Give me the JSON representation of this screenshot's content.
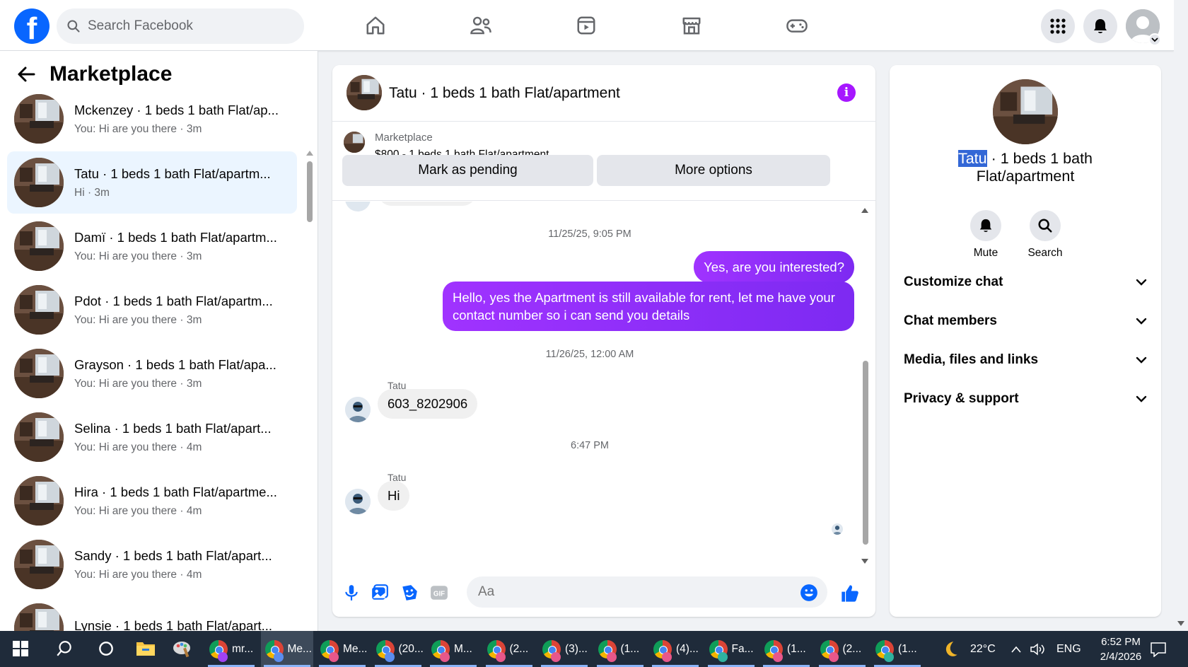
{
  "topbar": {
    "search_placeholder": "Search Facebook",
    "icons": [
      "home-icon",
      "friends-icon",
      "video-icon",
      "marketplace-icon",
      "gaming-icon",
      "menu-grid-icon",
      "notifications-icon",
      "profile-avatar"
    ]
  },
  "left": {
    "title": "Marketplace",
    "conversations": [
      {
        "name": "Mckenzey · 1 beds 1 bath Flat/ap...",
        "preview": "You: Hi are you there · 3m"
      },
      {
        "name": "Tatu · 1 beds 1 bath Flat/apartm...",
        "preview": "Hi · 3m"
      },
      {
        "name": "Damï · 1 beds 1 bath Flat/apartm...",
        "preview": "You: Hi are you there · 3m"
      },
      {
        "name": "Pdot · 1 beds 1 bath Flat/apartm...",
        "preview": "You: Hi are you there · 3m"
      },
      {
        "name": "Grayson · 1 beds 1 bath Flat/apa...",
        "preview": "You: Hi are you there · 3m"
      },
      {
        "name": "Selina · 1 beds 1 bath Flat/apart...",
        "preview": "You: Hi are you there · 4m"
      },
      {
        "name": "Hira · 1 beds 1 bath Flat/apartme...",
        "preview": "You: Hi are you there · 4m"
      },
      {
        "name": "Sandy · 1 beds 1 bath Flat/apart...",
        "preview": "You: Hi are you there · 4m"
      },
      {
        "name": "Lynsie · 1 beds 1 bath Flat/apart...",
        "preview": ""
      }
    ]
  },
  "chat": {
    "title": "Tatu · 1 beds 1 bath Flat/apartment",
    "marketplace_label": "Marketplace",
    "listing": "$800 - 1 beds 1 bath Flat/apartment",
    "mark_pending": "Mark as pending",
    "more_options": "More options",
    "ts1": "11/25/25, 9:05 PM",
    "out1": "Yes, are you interested?",
    "out2": "Hello, yes the Apartment is still available for rent, let me have your contact number so i can send you details",
    "ts2": "11/26/25, 12:00 AM",
    "sender1": "Tatu",
    "in1": "603_8202906",
    "ts3": "6:47 PM",
    "sender2": "Tatu",
    "in2": "Hi",
    "input_placeholder": "Aa"
  },
  "info": {
    "name_highlight": "Tatu",
    "name_rest": " · 1 beds 1 bath",
    "name_line2": "Flat/apartment",
    "mute": "Mute",
    "search": "Search",
    "sections": [
      "Customize chat",
      "Chat members",
      "Media, files and links",
      "Privacy & support"
    ]
  },
  "taskbar": {
    "apps": [
      {
        "label": "mr...",
        "badge": "#a142f4"
      },
      {
        "label": "Me...",
        "badge": "#5b8def"
      },
      {
        "label": "Me...",
        "badge": "#e8578a"
      },
      {
        "label": "(20...",
        "badge": "#5b8def"
      },
      {
        "label": "M...",
        "badge": "#e8578a"
      },
      {
        "label": "(2...",
        "badge": "#e8578a"
      },
      {
        "label": "(3)...",
        "badge": "#e8578a"
      },
      {
        "label": "(1...",
        "badge": "#e8578a"
      },
      {
        "label": "(4)...",
        "badge": "#e8578a"
      },
      {
        "label": "Fa...",
        "badge": "#2fb3a0"
      },
      {
        "label": "(1...",
        "badge": "#e8578a"
      },
      {
        "label": "(2...",
        "badge": "#e8578a"
      },
      {
        "label": "(1...",
        "badge": "#2fb3a0"
      }
    ],
    "weather": "22°C",
    "lang": "ENG",
    "time": "6:52 PM",
    "date": "2/4/2026"
  },
  "colors": {
    "brand_blue": "#0866ff",
    "message_purple": "#8f26f7",
    "active_conversation": "#ebf5ff"
  }
}
